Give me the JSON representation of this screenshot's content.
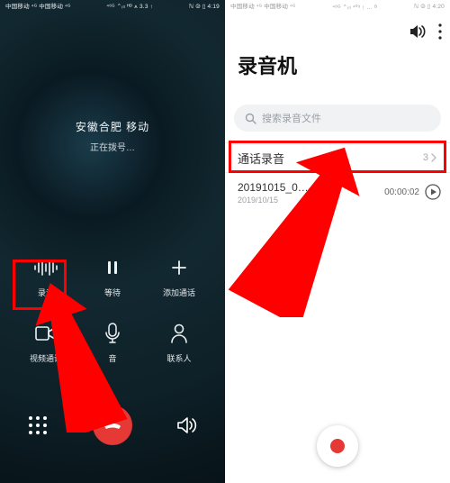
{
  "left": {
    "status": {
      "carrier": "中国移动 ⁴ᴳ\n中国移动 ⁴ᴳ",
      "net": "⁴⁶ᴳ ⌃ᵢₗₗ ᴴᴰ ⩚ 3.3 ↑",
      "right": "ℕ ⧁ ▯ 4:19"
    },
    "location": "安徽合肥 移动",
    "dialing": "正在拨号…",
    "actions": {
      "record": "录音",
      "hold": "等待",
      "add": "添加通话",
      "video": "视频通话",
      "mute": "音",
      "contacts": "联系人"
    }
  },
  "right": {
    "status": {
      "carrier": "中国移动 ⁴ᴳ\n中国移动 ⁴ᴳ",
      "net": "⁴⁶ᴳ ⌃ᵢₗₗ ⁴⁰³ ↑ … ᴮ",
      "right": "ℕ ⧁ ▯ 4:20"
    },
    "app_title": "录音机",
    "search_placeholder": "搜索录音文件",
    "section": {
      "title": "通话录音",
      "count": "3"
    },
    "file": {
      "name": "20191015_0…",
      "date": "2019/10/15",
      "dur": "00:00:02"
    }
  }
}
